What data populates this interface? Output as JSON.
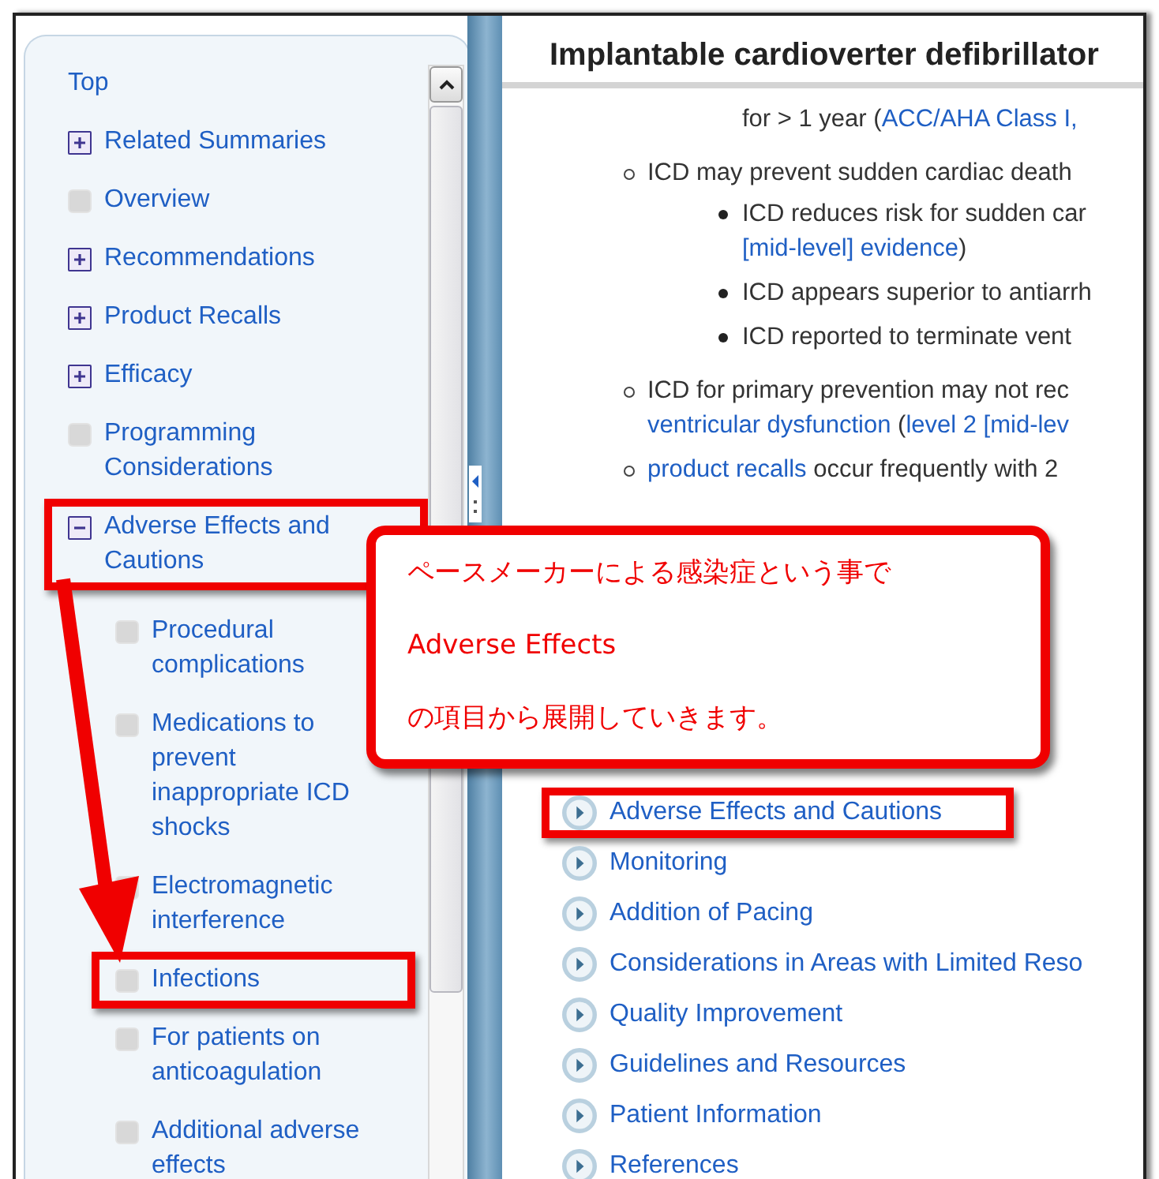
{
  "sidebar": {
    "items": [
      {
        "label": "Top",
        "kind": "link",
        "highlighted": false
      },
      {
        "label": "Related Summaries",
        "kind": "expander",
        "expanded": false,
        "highlighted": false
      },
      {
        "label": "Overview",
        "kind": "leaf",
        "highlighted": false
      },
      {
        "label": "Recommendations",
        "kind": "expander",
        "expanded": false,
        "highlighted": false
      },
      {
        "label": "Product Recalls",
        "kind": "expander",
        "expanded": false,
        "highlighted": false
      },
      {
        "label": "Efficacy",
        "kind": "expander",
        "expanded": false,
        "highlighted": false
      },
      {
        "label": "Programming Considerations",
        "kind": "leaf",
        "highlighted": false
      },
      {
        "label": "Adverse Effects and Cautions",
        "kind": "expander",
        "expanded": true,
        "highlighted": true,
        "children": [
          {
            "label": "Procedural complications",
            "kind": "leaf",
            "highlighted": false
          },
          {
            "label": "Medications to prevent inappropriate ICD shocks",
            "kind": "leaf",
            "highlighted": false
          },
          {
            "label": "Electromagnetic interference",
            "kind": "leaf",
            "highlighted": false
          },
          {
            "label": "Infections",
            "kind": "leaf",
            "highlighted": true
          },
          {
            "label": "For patients on anticoagulation",
            "kind": "leaf",
            "highlighted": false
          },
          {
            "label": "Additional adverse effects",
            "kind": "leaf",
            "highlighted": false
          }
        ]
      }
    ]
  },
  "content": {
    "title": "Implantable cardioverter defibrillator",
    "outline": [
      {
        "marker": false,
        "children": [
          {
            "marker": false,
            "lines": [
              [
                {
                  "text": "for > 1 year ("
                },
                {
                  "text": "ACC/AHA Class I,",
                  "link": true
                }
              ]
            ]
          }
        ]
      },
      {
        "marker": true,
        "lines": [
          [
            {
              "text": "ICD may prevent sudden cardiac death"
            }
          ]
        ],
        "children": [
          {
            "marker": true,
            "lines": [
              [
                {
                  "text": "ICD reduces risk for sudden car"
                }
              ],
              [
                {
                  "text": "[mid-level] evidence",
                  "link": true
                },
                {
                  "text": ")"
                }
              ]
            ]
          },
          {
            "marker": true,
            "lines": [
              [
                {
                  "text": "ICD appears superior to antiarrh"
                }
              ]
            ]
          },
          {
            "marker": true,
            "lines": [
              [
                {
                  "text": "ICD reported to terminate vent"
                }
              ]
            ]
          }
        ]
      },
      {
        "marker": true,
        "lines": [
          [
            {
              "text": "ICD for primary prevention may not rec"
            }
          ],
          [
            {
              "text": "ventricular dysfunction",
              "link": true
            },
            {
              "text": " ("
            },
            {
              "text": "level 2 [mid-lev",
              "link": true
            }
          ]
        ]
      },
      {
        "marker": true,
        "lines": [
          [
            {
              "text": "product recalls",
              "link": true
            },
            {
              "text": " occur frequently with 2"
            }
          ]
        ]
      }
    ],
    "sections": [
      {
        "label": "Adverse Effects and Cautions",
        "highlighted": true
      },
      {
        "label": "Monitoring",
        "highlighted": false
      },
      {
        "label": "Addition of Pacing",
        "highlighted": false
      },
      {
        "label": "Considerations in Areas with Limited Reso",
        "highlighted": false
      },
      {
        "label": "Quality Improvement",
        "highlighted": false
      },
      {
        "label": "Guidelines and Resources",
        "highlighted": false
      },
      {
        "label": "Patient Information",
        "highlighted": false
      },
      {
        "label": "References",
        "highlighted": false
      }
    ]
  },
  "callout": {
    "lines": [
      "ペースメーカーによる感染症という事で",
      "Adverse Effects",
      "の項目から展開していきます。"
    ]
  }
}
